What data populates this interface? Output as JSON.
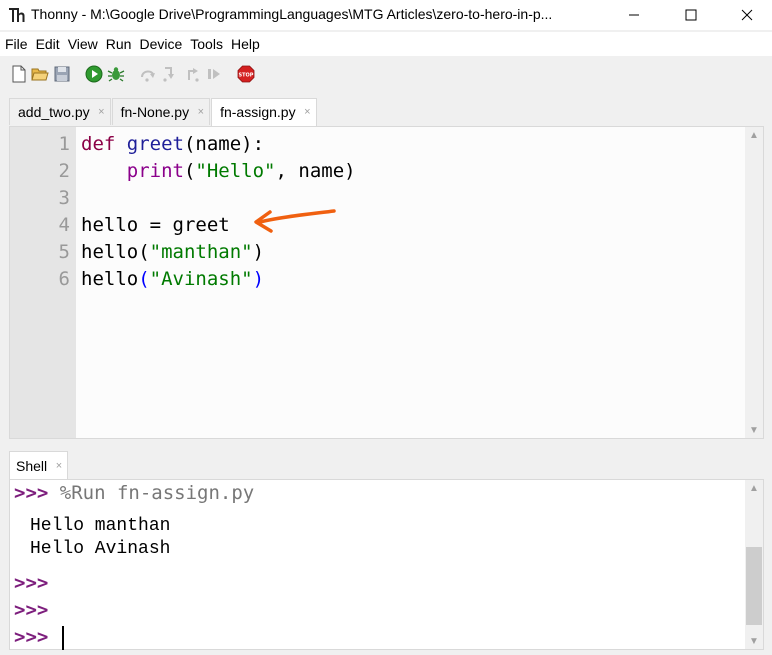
{
  "window": {
    "title": "Thonny  -  M:\\Google Drive\\ProgrammingLanguages\\MTG Articles\\zero-to-hero-in-p..."
  },
  "menu": {
    "items": [
      "File",
      "Edit",
      "View",
      "Run",
      "Device",
      "Tools",
      "Help"
    ]
  },
  "toolbar": {
    "icons": [
      "new-file-icon",
      "open-file-icon",
      "save-icon",
      "run-icon",
      "debug-icon",
      "step-over-icon",
      "step-into-icon",
      "step-out-icon",
      "resume-icon",
      "stop-icon"
    ],
    "stop_label": "STOP"
  },
  "editor": {
    "tabs": [
      {
        "label": "add_two.py",
        "close": "×"
      },
      {
        "label": "fn-None.py",
        "close": "×"
      },
      {
        "label": "fn-assign.py",
        "close": "×"
      }
    ],
    "active_tab": "fn-assign.py",
    "line_numbers": [
      "1",
      "2",
      "3",
      "4",
      "5",
      "6"
    ],
    "lines": {
      "l1": {
        "kw": "def",
        "fn": "greet",
        "rest": "(name):"
      },
      "l2": {
        "indent": "    ",
        "builtin": "print",
        "open": "(",
        "str": "\"Hello\"",
        "rest": ", name)"
      },
      "l4": {
        "text": "hello = greet"
      },
      "l5": {
        "name": "hello",
        "open": "(",
        "str": "\"manthan\"",
        "close": ")"
      },
      "l6": {
        "name": "hello",
        "open": "(",
        "str": "\"Avinash\"",
        "close": ")"
      }
    }
  },
  "shell": {
    "tab_label": "Shell",
    "tab_close": "×",
    "prompt": ">>>",
    "command": "%Run fn-assign.py",
    "output": [
      "Hello manthan",
      "Hello Avinash"
    ]
  },
  "colors": {
    "keyword": "#8b0046",
    "string": "#007a00",
    "prompt": "#7d1e7d",
    "annotation_arrow": "#f06010"
  }
}
